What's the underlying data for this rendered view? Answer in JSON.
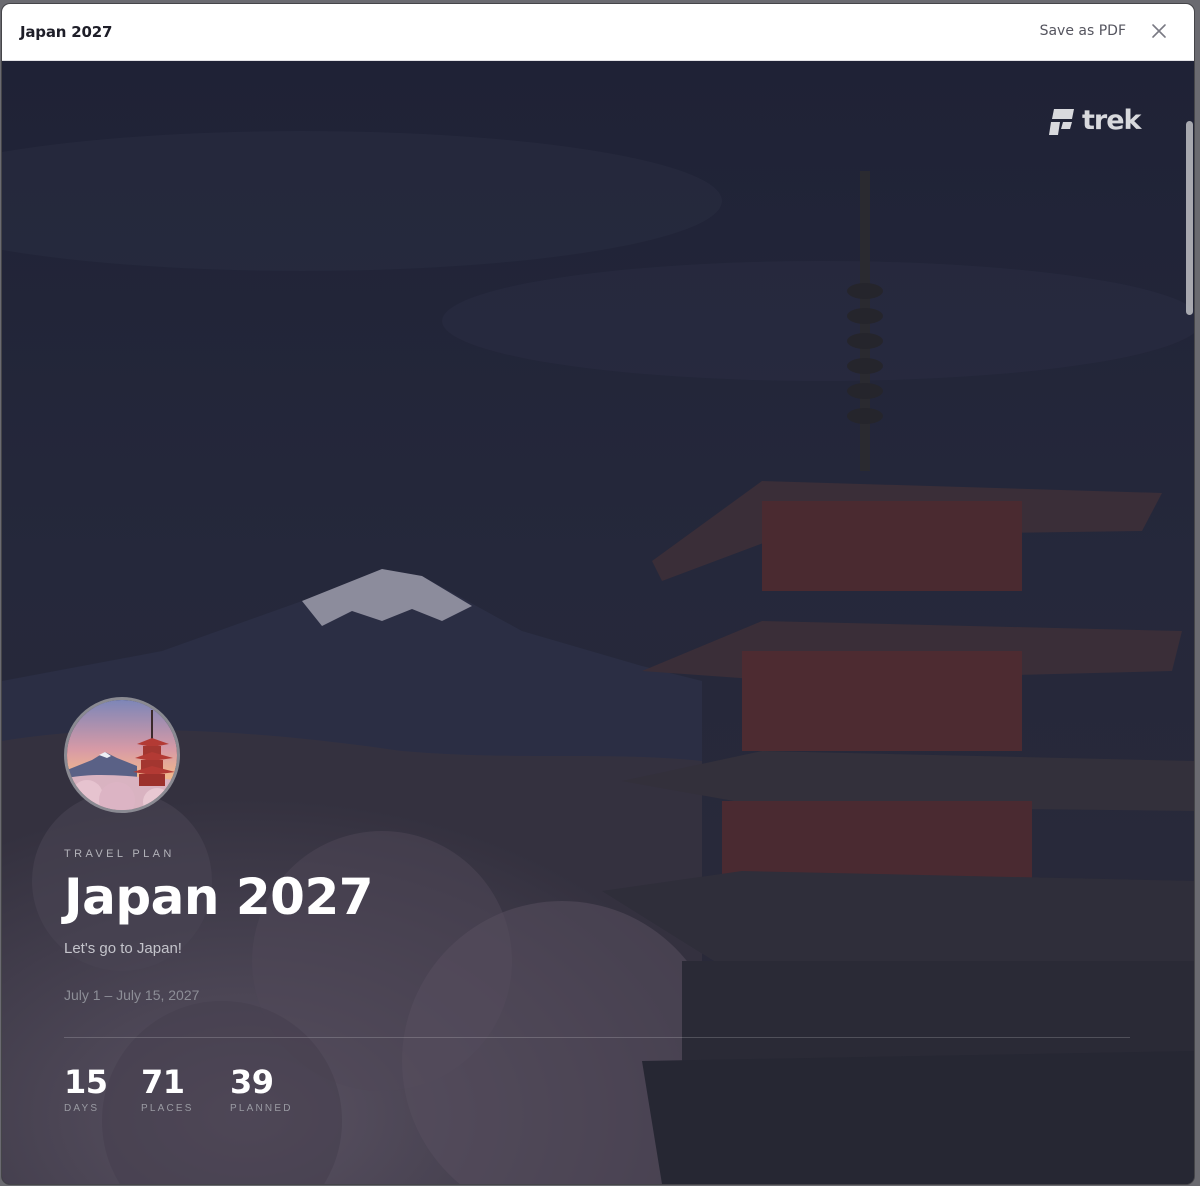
{
  "window": {
    "title": "Japan 2027",
    "save_pdf_label": "Save as PDF"
  },
  "logo": {
    "text": "trek"
  },
  "hero": {
    "eyebrow": "TRAVEL PLAN",
    "title": "Japan 2027",
    "subtitle": "Let's go to Japan!",
    "dates": "July 1 – July 15, 2027"
  },
  "stats": [
    {
      "value": "15",
      "label": "DAYS"
    },
    {
      "value": "71",
      "label": "PLACES"
    },
    {
      "value": "39",
      "label": "PLANNED"
    }
  ],
  "icons": {
    "close": "close-icon",
    "logo": "trek-logo-icon"
  },
  "colors": {
    "hero_overlay": "#1a1c2c",
    "title_text": "#ffffff",
    "muted_text": "#8d8e97"
  }
}
